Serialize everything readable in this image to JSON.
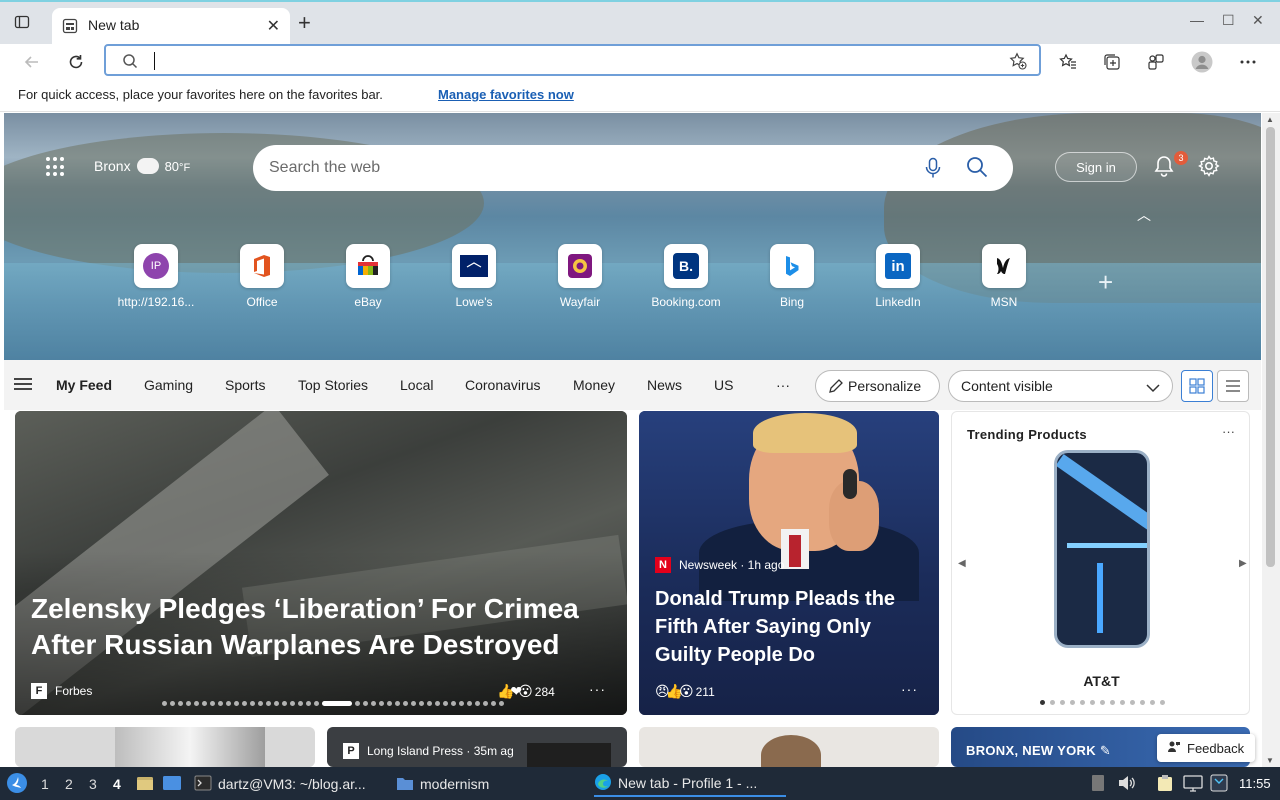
{
  "browser": {
    "tab_title": "New tab",
    "address_value": "",
    "favorites_bar_text": "For quick access, place your favorites here on the favorites bar.",
    "favorites_bar_link": "Manage favorites now"
  },
  "hero": {
    "location": "Bronx",
    "temperature": "80",
    "temp_unit": "°F",
    "search_placeholder": "Search the web",
    "sign_in": "Sign in",
    "notification_count": "3",
    "quick_links": [
      {
        "label": "http://192.16...",
        "icon": "ip-avatar-icon",
        "badge": "IP"
      },
      {
        "label": "Office",
        "icon": "office-icon"
      },
      {
        "label": "eBay",
        "icon": "ebay-icon"
      },
      {
        "label": "Lowe's",
        "icon": "lowes-icon"
      },
      {
        "label": "Wayfair",
        "icon": "wayfair-icon"
      },
      {
        "label": "Booking.com",
        "icon": "booking-icon",
        "badge": "B."
      },
      {
        "label": "Bing",
        "icon": "bing-icon"
      },
      {
        "label": "LinkedIn",
        "icon": "linkedin-icon",
        "badge": "in"
      },
      {
        "label": "MSN",
        "icon": "msn-icon"
      }
    ]
  },
  "feed_nav": {
    "items": [
      "My Feed",
      "Gaming",
      "Sports",
      "Top Stories",
      "Local",
      "Coronavirus",
      "Money",
      "News",
      "US"
    ],
    "more": "···",
    "personalize": "Personalize",
    "content_visibility": "Content visible"
  },
  "cards": {
    "main": {
      "headline": "Zelensky Pledges ‘Liberation’ For Crimea After Russian Warplanes Are Destroyed",
      "source": "Forbes",
      "source_logo": "F",
      "reactions": "284",
      "more": "···"
    },
    "second": {
      "source": "Newsweek · 1h ago",
      "source_logo": "N",
      "headline": "Donald Trump Pleads the Fifth After Saying Only Guilty People Do",
      "reactions": "211",
      "more": "···"
    },
    "trending": {
      "title": "Trending Products",
      "more": "···",
      "brand": "AT&T"
    },
    "lower_source": "Long Island Press · 35m ag",
    "lower_source_logo": "P",
    "location_card": "BRONX, NEW YORK",
    "feedback": "Feedback"
  },
  "taskbar": {
    "workspaces": [
      "1",
      "2",
      "3",
      "4"
    ],
    "tasks": [
      "dartz@VM3: ~/blog.ar...",
      "modernism",
      "New tab - Profile 1 - ..."
    ],
    "clock": "11:55"
  },
  "colors": {
    "accent": "#1a5fb4",
    "address_border": "#6f9fd8",
    "taskbar": "#1f2a38",
    "notification_badge": "#e25c3b"
  }
}
